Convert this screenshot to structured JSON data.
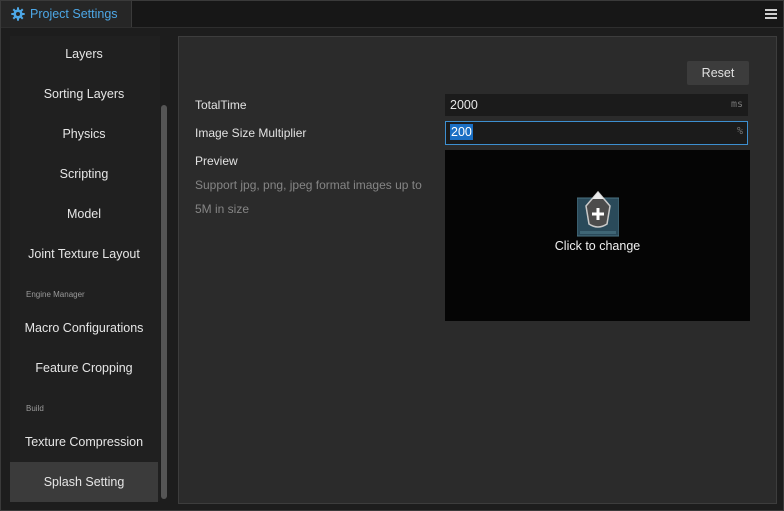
{
  "tab": {
    "title": "Project Settings",
    "icon": "gear-icon"
  },
  "sidebar": {
    "items": [
      {
        "label": "Layers"
      },
      {
        "label": "Sorting Layers"
      },
      {
        "label": "Physics"
      },
      {
        "label": "Scripting"
      },
      {
        "label": "Model"
      },
      {
        "label": "Joint Texture Layout"
      }
    ],
    "group_engine": "Engine Manager",
    "engine_items": [
      {
        "label": "Macro Configurations"
      },
      {
        "label": "Feature Cropping"
      }
    ],
    "group_build": "Build",
    "build_items": [
      {
        "label": "Texture Compression"
      },
      {
        "label": "Splash Setting"
      }
    ],
    "active": "Splash Setting"
  },
  "panel": {
    "reset_label": "Reset",
    "total_time": {
      "label": "TotalTime",
      "value": "2000",
      "unit": "ms"
    },
    "image_size": {
      "label": "Image Size Multiplier",
      "value": "200",
      "unit": "%"
    },
    "preview": {
      "label": "Preview",
      "hint": "Support jpg, png, jpeg format images up to 5M in size",
      "overlay_text": "Click to change"
    }
  },
  "colors": {
    "accent": "#4da7e6",
    "selection": "#1a6fc4",
    "focus_border": "#3d8fd0"
  }
}
